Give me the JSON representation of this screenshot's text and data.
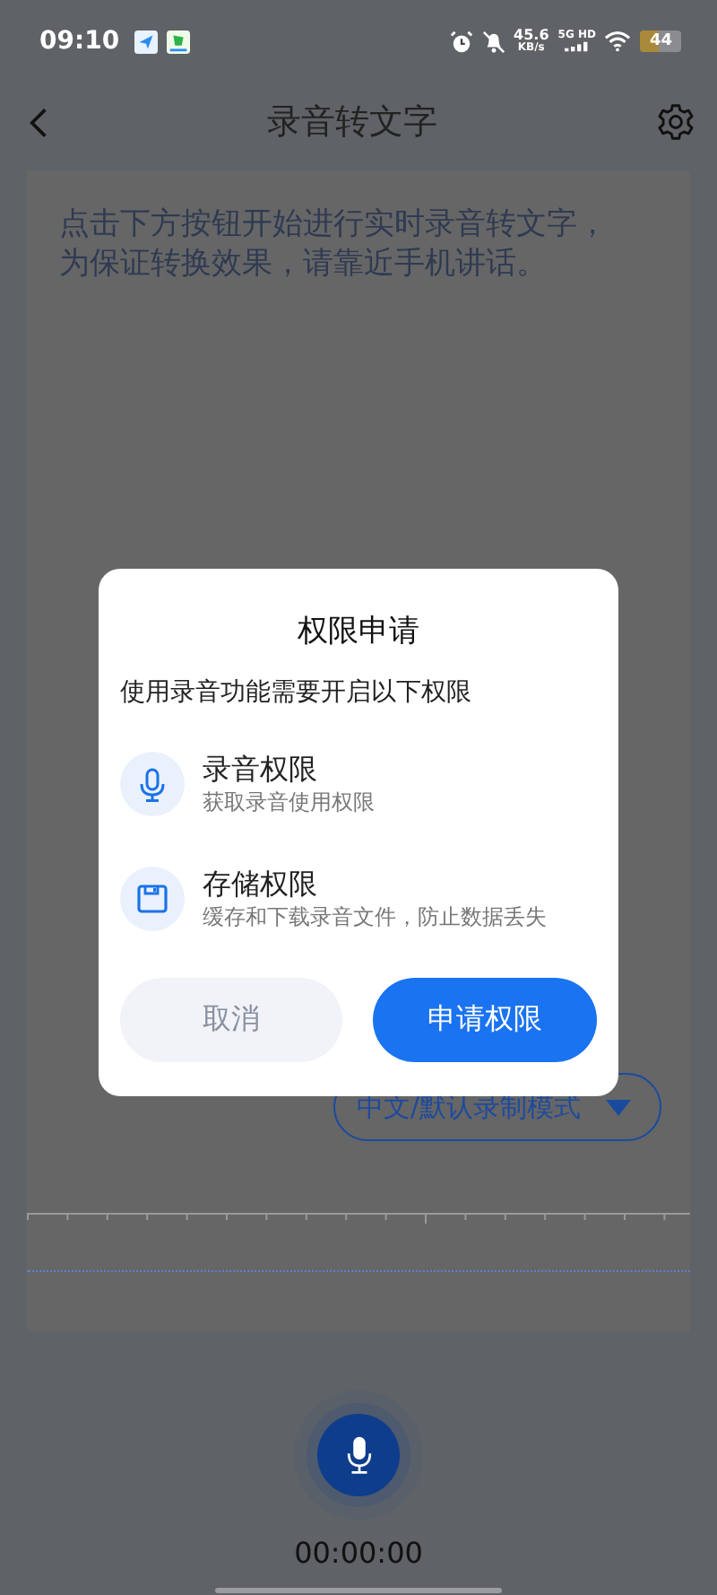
{
  "status_bar": {
    "time": "09:10",
    "network_speed": "45.6",
    "network_speed_unit": "KB/s",
    "network_type": "5G HD",
    "battery": "44"
  },
  "header": {
    "title": "录音转文字"
  },
  "hint": "点击下方按钮开始进行实时录音转文字，为保证转换效果，请靠近手机讲话。",
  "mode_selector": {
    "label": "中文/默认录制模式"
  },
  "recorder": {
    "timer": "00:00:00"
  },
  "dialog": {
    "title": "权限申请",
    "message": "使用录音功能需要开启以下权限",
    "permissions": [
      {
        "kind": "microphone",
        "title": "录音权限",
        "description": "获取录音使用权限"
      },
      {
        "kind": "storage",
        "title": "存储权限",
        "description": "缓存和下载录音文件，防止数据丢失"
      }
    ],
    "buttons": [
      {
        "kind": "secondary",
        "label": "取消"
      },
      {
        "kind": "primary",
        "label": "申请权限"
      }
    ]
  }
}
